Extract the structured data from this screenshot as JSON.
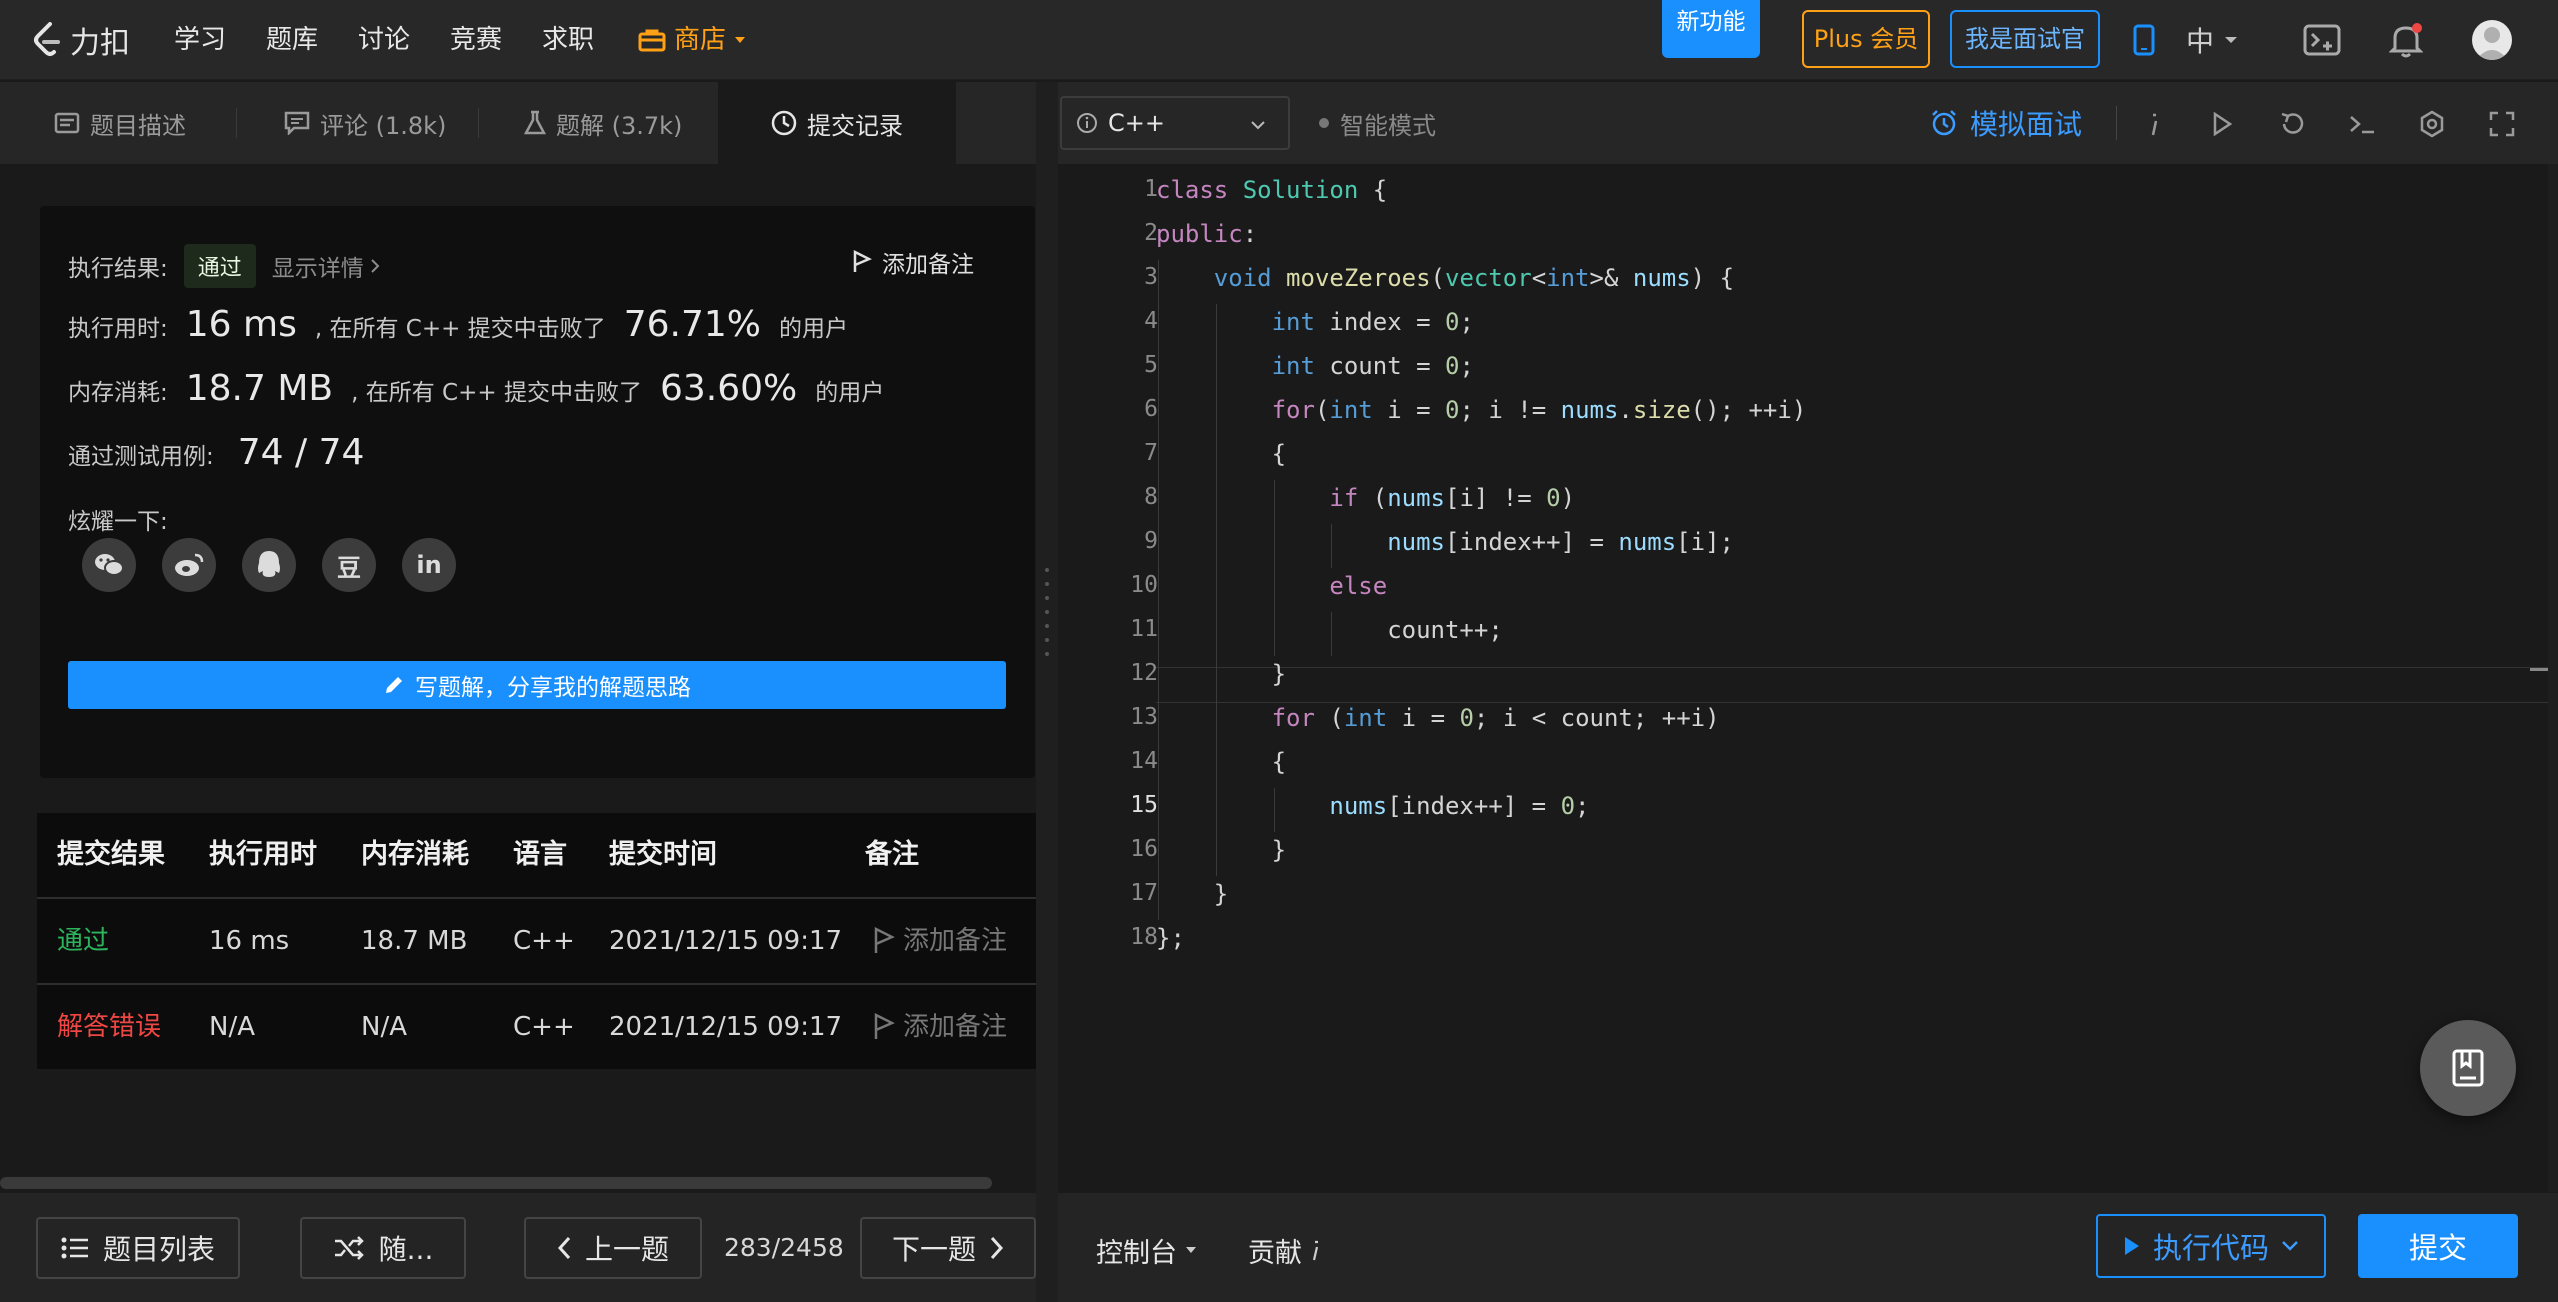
{
  "nav": {
    "logo_text": "力扣",
    "links": [
      "学习",
      "题库",
      "讨论",
      "竞赛",
      "求职"
    ],
    "store": "商店",
    "new_feature": "新功能",
    "plus": "Plus 会员",
    "interviewer": "我是面试官",
    "lang": "中"
  },
  "left_tabs": {
    "description": "题目描述",
    "comments": "评论 (1.8k)",
    "solutions": "题解 (3.7k)",
    "submissions": "提交记录"
  },
  "result": {
    "status_label": "执行结果:",
    "status": "通过",
    "details": "显示详情",
    "add_note": "添加备注",
    "runtime_label": "执行用时:",
    "runtime": "16 ms",
    "runtime_mid": ", 在所有 C++ 提交中击败了",
    "runtime_pct": "76.71%",
    "runtime_suffix": "的用户",
    "memory_label": "内存消耗:",
    "memory": "18.7 MB",
    "memory_mid": ", 在所有 C++ 提交中击败了",
    "memory_pct": "63.60%",
    "memory_suffix": "的用户",
    "tests_label": "通过测试用例:",
    "tests": "74 / 74",
    "share_label": "炫耀一下:",
    "share_icons": [
      "wechat-icon",
      "weibo-icon",
      "qq-icon",
      "douban-icon",
      "linkedin-icon"
    ],
    "douban_glyph": "豆",
    "linkedin_glyph": "in",
    "write_solution": "写题解，分享我的解题思路"
  },
  "table": {
    "headers": [
      "提交结果",
      "执行用时",
      "内存消耗",
      "语言",
      "提交时间",
      "备注"
    ],
    "rows": [
      {
        "result": "通过",
        "runtime": "16 ms",
        "memory": "18.7 MB",
        "lang": "C++",
        "time": "2021/12/15 09:17",
        "note": "添加备注"
      },
      {
        "result": "解答错误",
        "runtime": "N/A",
        "memory": "N/A",
        "lang": "C++",
        "time": "2021/12/15 09:17",
        "note": "添加备注"
      }
    ]
  },
  "bottom_left": {
    "problem_list": "题目列表",
    "random": "随...",
    "prev": "上一题",
    "pager": "283/2458",
    "next": "下一题"
  },
  "editor": {
    "language": "C++",
    "smart_mode": "智能模式",
    "mock_interview": "模拟面试",
    "current_line": 15,
    "lines": [
      "class Solution {",
      "public:",
      "    void moveZeroes(vector<int>& nums) {",
      "        int index = 0;",
      "        int count = 0;",
      "        for(int i = 0; i != nums.size(); ++i)",
      "        {",
      "            if (nums[i] != 0)",
      "                nums[index++] = nums[i];",
      "            else",
      "                count++;",
      "        }",
      "        for (int i = 0; i < count; ++i)",
      "        {",
      "            nums[index++] = 0;",
      "        }",
      "    }",
      "};"
    ]
  },
  "bottom_right": {
    "console": "控制台",
    "contribute": "贡献",
    "run": "执行代码",
    "submit": "提交"
  },
  "colors": {
    "accent": "#1a90ff",
    "store": "#ffa116",
    "pass": "#2db55d",
    "error": "#ef4743"
  }
}
